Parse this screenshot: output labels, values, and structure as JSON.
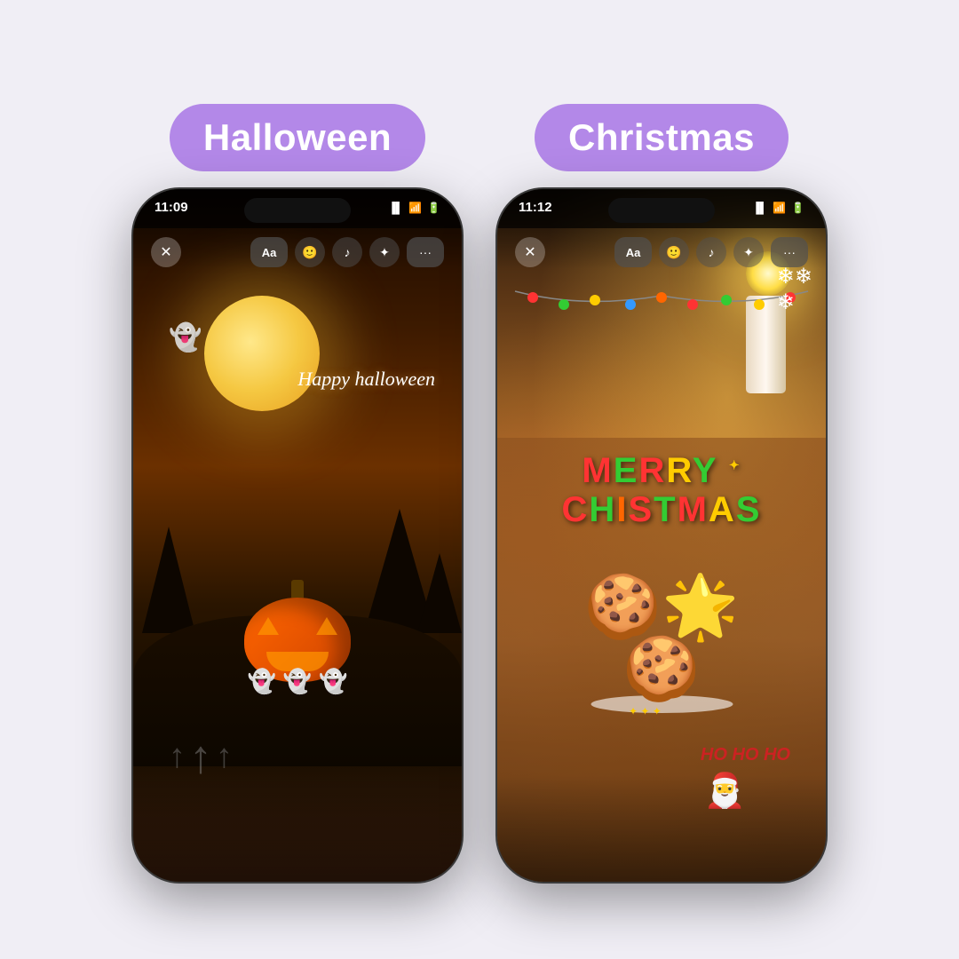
{
  "background_color": "#f0eef5",
  "halloween": {
    "badge_label": "Halloween",
    "badge_color": "#b388e8",
    "status_time": "11:09",
    "happy_halloween_text": "Happy\nhalloween",
    "ghost_emoji": "👻",
    "ghost_row": "👻👻👻",
    "arrow_icons": "↑↑↑",
    "toolbar": {
      "close_label": "✕",
      "aa_label": "Aa",
      "emoji_label": "🙂",
      "music_label": "♪",
      "sparkle_label": "✦",
      "dots_label": "···"
    }
  },
  "christmas": {
    "badge_label": "Christmas",
    "badge_color": "#b388e8",
    "status_time": "11:12",
    "merry_text": "MERRY",
    "christmas_text": "CHRISTMAS",
    "ho_ho_ho_text": "HO\nHO\nHO",
    "snowflake": "❄",
    "santa": "🎅",
    "toolbar": {
      "close_label": "✕",
      "aa_label": "Aa",
      "emoji_label": "🙂",
      "music_label": "♪",
      "sparkle_label": "✦",
      "dots_label": "···"
    },
    "light_colors": [
      "#ff3333",
      "#33cc33",
      "#ffcc00",
      "#3399ff",
      "#ff6600",
      "#ff3333",
      "#33cc33",
      "#ffcc00"
    ]
  }
}
